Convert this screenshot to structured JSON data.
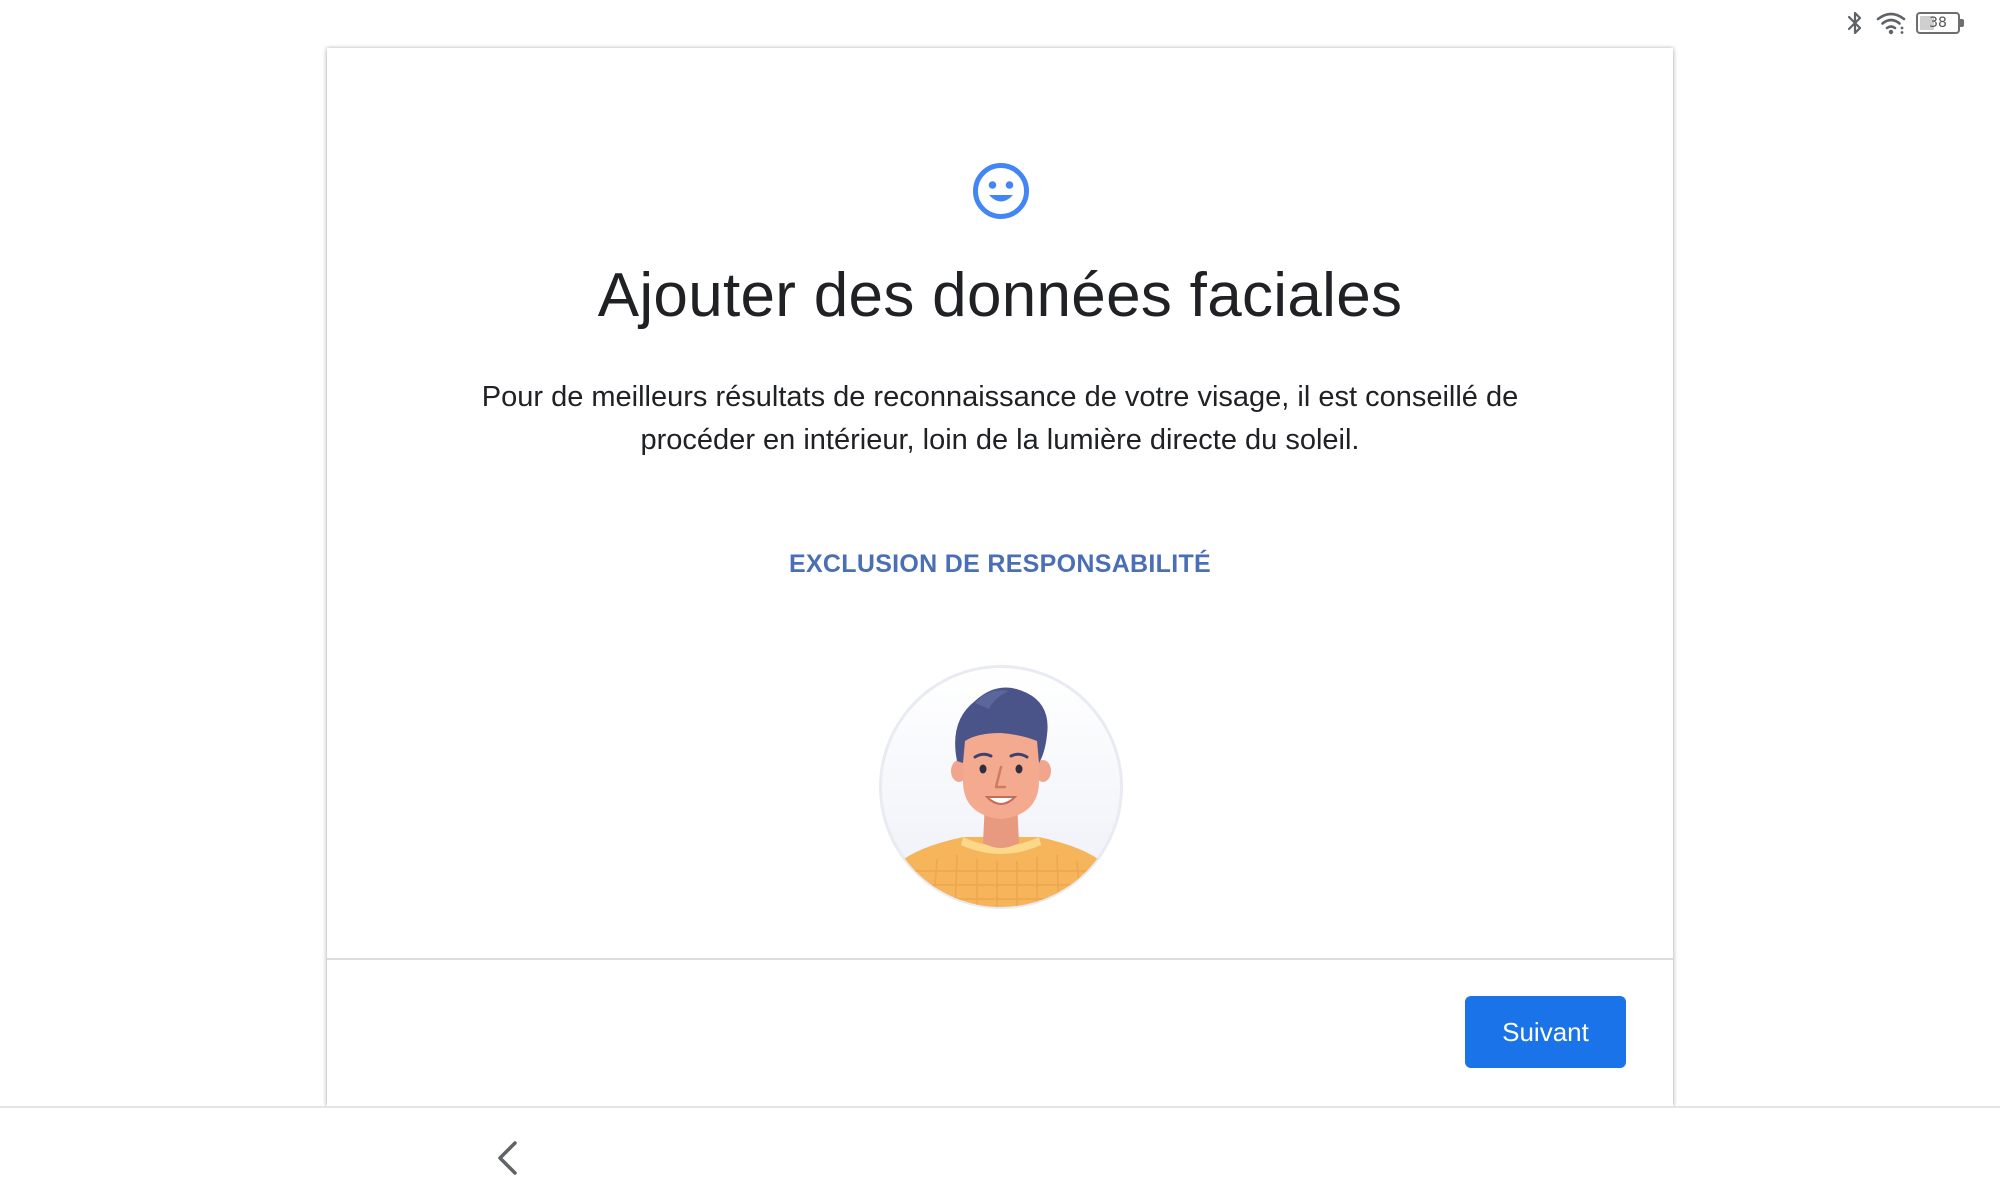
{
  "status_bar": {
    "icons": [
      "bluetooth-icon",
      "wifi-icon",
      "battery-icon"
    ],
    "battery_level": "38"
  },
  "dialog": {
    "header_icon": "face-smile-icon",
    "title": "Ajouter des données faciales",
    "description": "Pour de meilleurs résultats de reconnaissance de votre visage, il est conseillé de procéder en intérieur, loin de la lumière directe du soleil.",
    "disclaimer_link": "EXCLUSION DE RESPONSABILITÉ",
    "illustration": "face-avatar-illustration",
    "next_button": "Suivant"
  },
  "nav_bar": {
    "back_icon": "back-chevron-icon"
  },
  "colors": {
    "accent": "#1a73e8",
    "link": "#4a6fb5",
    "icon_blue": "#4285f4",
    "text": "#202124"
  }
}
